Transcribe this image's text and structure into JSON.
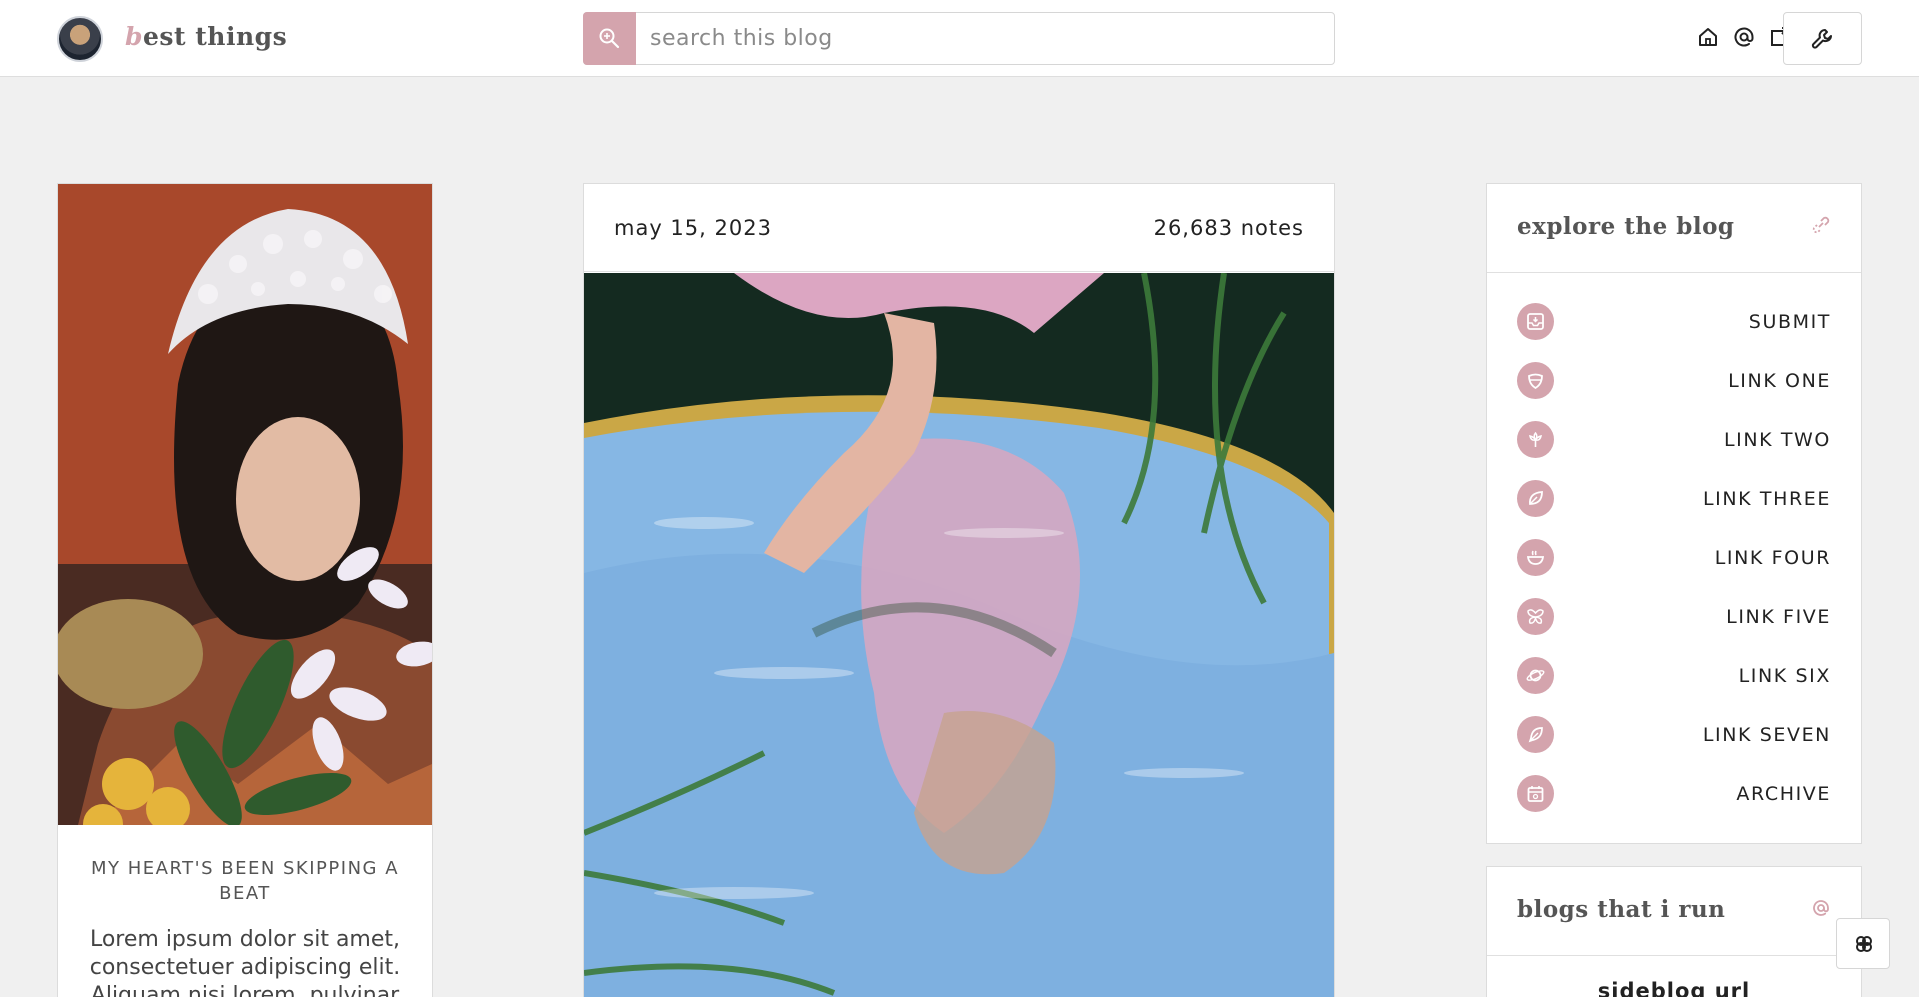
{
  "header": {
    "brand_first": "b",
    "brand_rest": "est things",
    "search_placeholder": "search this blog",
    "icons": [
      "home-icon",
      "at-icon",
      "external-icon"
    ],
    "tool_icon": "wrench-icon"
  },
  "left_card": {
    "caption": "MY HEART'S BEEN SKIPPING A BEAT",
    "body": "Lorem ipsum dolor sit amet, consectetuer adipiscing elit. Aliquam nisi lorem, pulvinar"
  },
  "post": {
    "date": "may 15, 2023",
    "notes": "26,683 notes"
  },
  "sidebar": {
    "explore_title": "explore the blog",
    "links": [
      {
        "label": "SUBMIT",
        "icon": "inbox-icon"
      },
      {
        "label": "LINK ONE",
        "icon": "shield-icon"
      },
      {
        "label": "LINK TWO",
        "icon": "flower-icon"
      },
      {
        "label": "LINK THREE",
        "icon": "leaf-icon"
      },
      {
        "label": "LINK FOUR",
        "icon": "bowl-icon"
      },
      {
        "label": "LINK FIVE",
        "icon": "butterfly-icon"
      },
      {
        "label": "LINK SIX",
        "icon": "planet-icon"
      },
      {
        "label": "LINK SEVEN",
        "icon": "feather-icon"
      },
      {
        "label": "ARCHIVE",
        "icon": "calendar-icon"
      }
    ],
    "blogs_title": "blogs that i run",
    "blogs_first": "sideblog url"
  },
  "colors": {
    "accent": "#d4a4ad",
    "background": "#f0f0f0",
    "card": "#ffffff"
  }
}
